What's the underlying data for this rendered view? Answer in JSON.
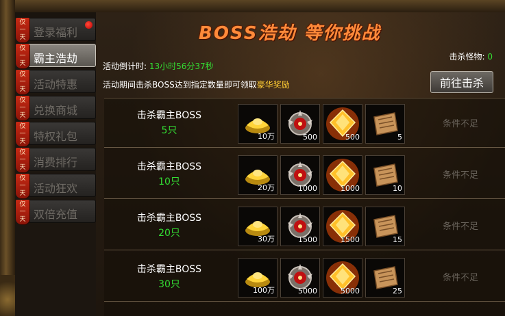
{
  "sidebar": {
    "tag_text": [
      "仅",
      "一",
      "天"
    ],
    "items": [
      {
        "label": "登录福利",
        "active": false,
        "dot": true
      },
      {
        "label": "霸主浩劫",
        "active": true,
        "dot": false
      },
      {
        "label": "活动特惠",
        "active": false,
        "dot": false
      },
      {
        "label": "兑换商城",
        "active": false,
        "dot": false
      },
      {
        "label": "特权礼包",
        "active": false,
        "dot": false
      },
      {
        "label": "消费排行",
        "active": false,
        "dot": false
      },
      {
        "label": "活动狂欢",
        "active": false,
        "dot": false
      },
      {
        "label": "双倍充值",
        "active": false,
        "dot": false
      }
    ]
  },
  "main": {
    "banner": "BOSS浩劫  等你挑战",
    "countdown_label": "活动倒计时:",
    "countdown_value": "13小时56分37秒",
    "desc_prefix": "活动期间击杀BOSS达到指定数量即可领取",
    "desc_highlight": "豪华奖励",
    "kill_label": "击杀怪物:",
    "kill_value": "0",
    "go_button": "前往击杀"
  },
  "rows": [
    {
      "title": "击杀霸主BOSS",
      "count": "5只",
      "rewards": [
        "10万",
        "500",
        "500",
        "5"
      ],
      "status": "条件不足"
    },
    {
      "title": "击杀霸主BOSS",
      "count": "10只",
      "rewards": [
        "20万",
        "1000",
        "1000",
        "10"
      ],
      "status": "条件不足"
    },
    {
      "title": "击杀霸主BOSS",
      "count": "20只",
      "rewards": [
        "30万",
        "1500",
        "1500",
        "15"
      ],
      "status": "条件不足"
    },
    {
      "title": "击杀霸主BOSS",
      "count": "30只",
      "rewards": [
        "100万",
        "5000",
        "5000",
        "25"
      ],
      "status": "条件不足"
    }
  ],
  "reward_icons": [
    "gold-ingot-icon",
    "demon-mask-icon",
    "gold-gem-icon",
    "scroll-icon"
  ],
  "colors": {
    "accent_green": "#33dd33",
    "highlight_gold": "#ffcc33",
    "banner": "#ff8a3a",
    "tag_red": "#c82a14"
  }
}
